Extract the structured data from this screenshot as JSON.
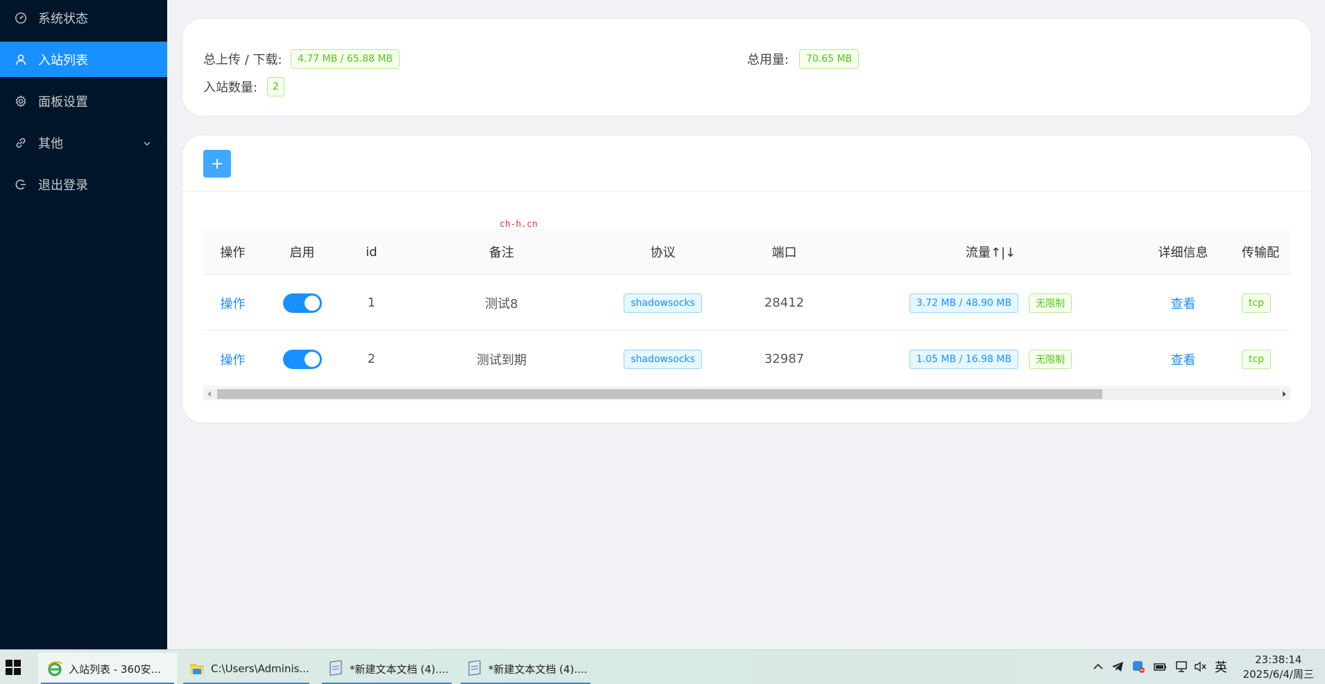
{
  "sidebar": {
    "items": [
      {
        "label": "系统状态",
        "icon": "dashboard-icon"
      },
      {
        "label": "入站列表",
        "icon": "user-icon",
        "active": true
      },
      {
        "label": "面板设置",
        "icon": "gear-icon"
      },
      {
        "label": "其他",
        "icon": "link-icon"
      },
      {
        "label": "退出登录",
        "icon": "logout-icon"
      }
    ]
  },
  "summary": {
    "traffic_label": "总上传 / 下载:",
    "traffic_value": "4.77 MB / 65.88 MB",
    "total_label": "总用量:",
    "total_value": "70.65 MB",
    "count_label": "入站数量:",
    "count_value": "2"
  },
  "watermark": "ch-h.cn",
  "table": {
    "columns": [
      "操作",
      "启用",
      "id",
      "备注",
      "协议",
      "端口",
      "流量↑|↓",
      "详细信息",
      "传输配"
    ],
    "rows": [
      {
        "action": "操作",
        "enabled": true,
        "id": "1",
        "remark": "测试8",
        "protocol": "shadowsocks",
        "port": "28412",
        "traffic": "3.72 MB / 48.90 MB",
        "limit": "无限制",
        "details": "查看",
        "transport": "tcp"
      },
      {
        "action": "操作",
        "enabled": true,
        "id": "2",
        "remark": "测试到期",
        "protocol": "shadowsocks",
        "port": "32987",
        "traffic": "1.05 MB / 16.98 MB",
        "limit": "无限制",
        "details": "查看",
        "transport": "tcp"
      }
    ]
  },
  "taskbar": {
    "items": [
      {
        "label": "入站列表 - 360安...",
        "icon": "ie-browser-icon"
      },
      {
        "label": "C:\\Users\\Adminis...",
        "icon": "folder-icon"
      },
      {
        "label": "*新建文本文档 (4)....",
        "icon": "notepad-icon"
      },
      {
        "label": "*新建文本文档 (4)....",
        "icon": "notepad-icon"
      }
    ],
    "ime": "英",
    "time": "23:38:14",
    "date": "2025/6/4/周三"
  },
  "colors": {
    "sidebar_bg": "#001529",
    "accent": "#1890ff",
    "tag_green": "#52c41a"
  }
}
